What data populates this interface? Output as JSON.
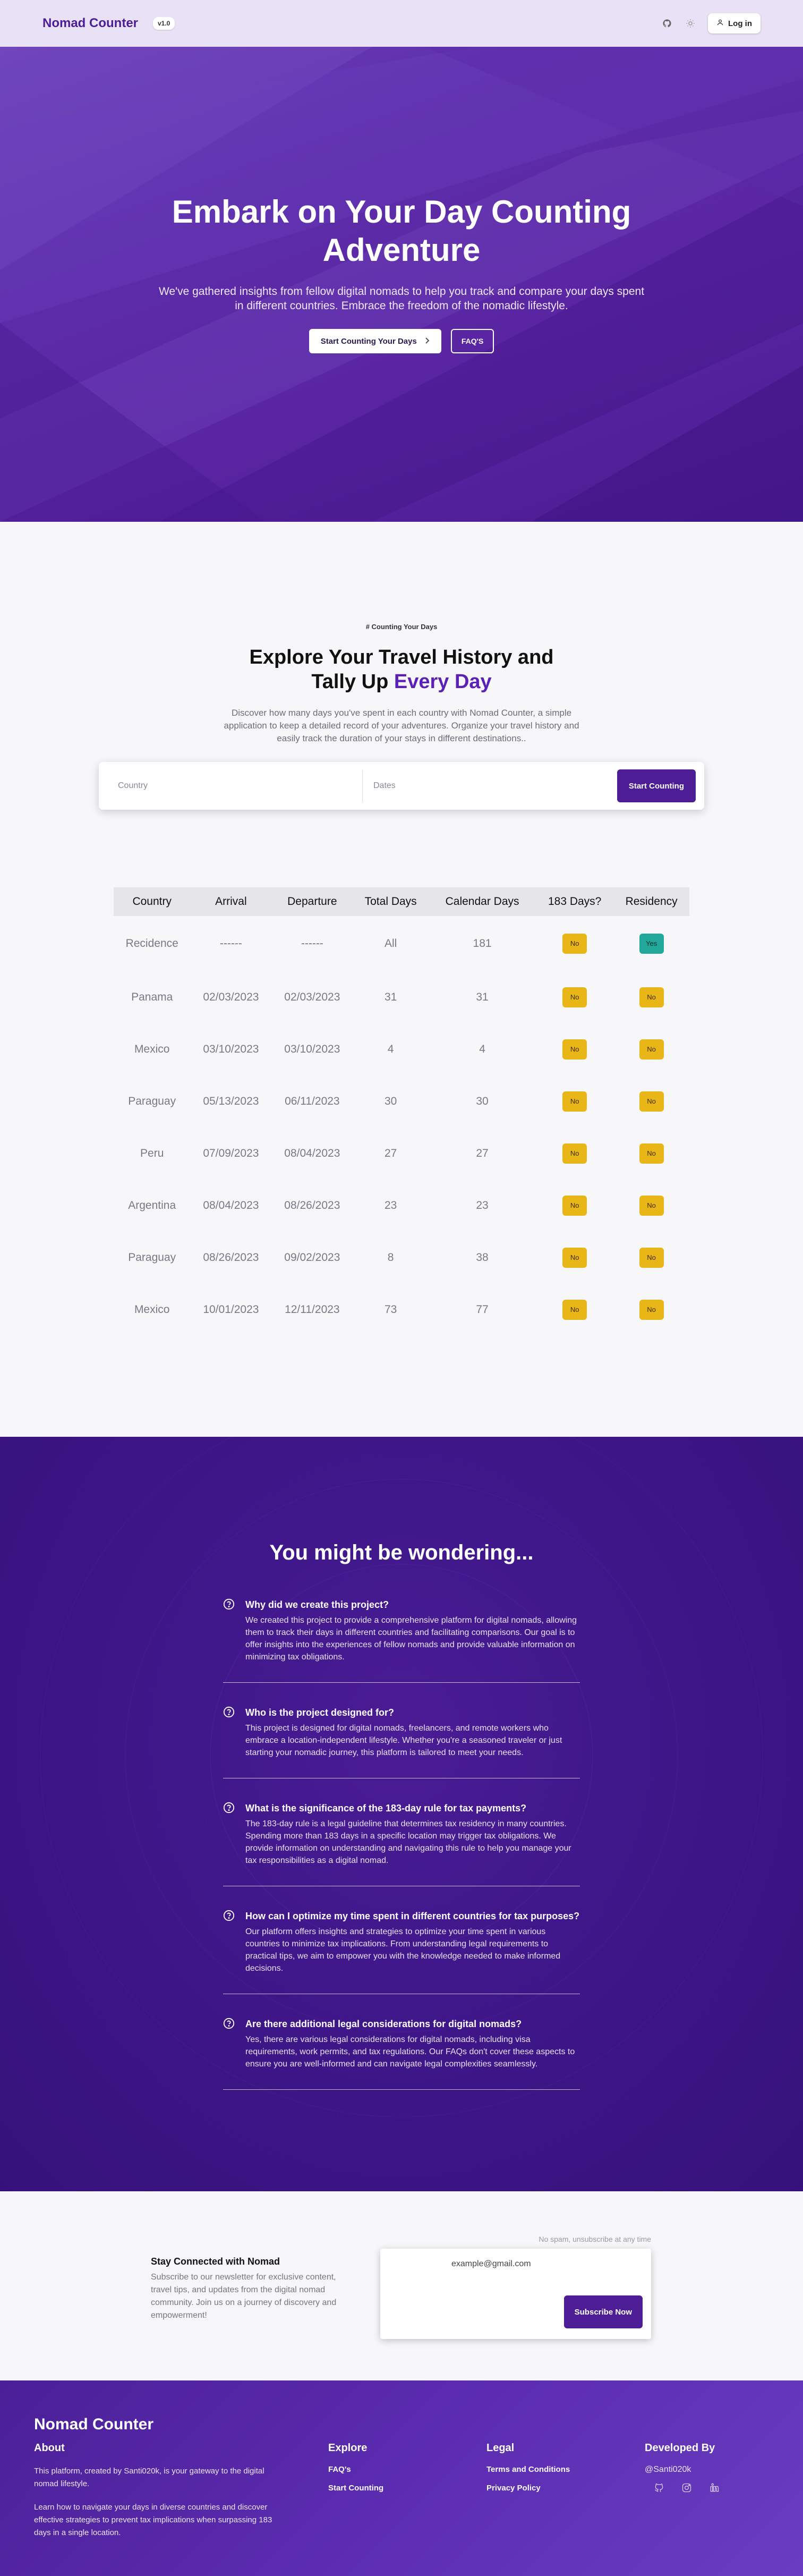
{
  "nav": {
    "brand": "Nomad Counter",
    "version": "v1.0",
    "login_label": "Log in",
    "icons": [
      "github-icon",
      "theme-toggle-icon",
      "user-icon"
    ]
  },
  "hero": {
    "title": "Embark on Your Day Counting Adventure",
    "subtitle": "We've gathered insights from fellow digital nomads to help you track and compare your days spent in different countries. Embrace the freedom of the nomadic lifestyle.",
    "primary_button": "Start Counting Your Days",
    "secondary_button": "FAQ'S"
  },
  "explore": {
    "kicker": "# Counting Your Days",
    "title_part1": "Explore Your Travel History and",
    "title_part2": "Tally Up",
    "title_accent": "Every Day",
    "description": "Discover how many days you've spent in each country with Nomad Counter, a simple application to keep a detailed record of your adventures. Organize your travel history and easily track the duration of your stays in different destinations..",
    "country_placeholder": "Country",
    "dates_placeholder": "Dates",
    "start_button": "Start Counting"
  },
  "table": {
    "headers": [
      "Country",
      "Arrival",
      "Departure",
      "Total Days",
      "Calendar Days",
      "183 Days?",
      "Residency"
    ],
    "rows": [
      {
        "country": "Recidence",
        "arrival": "------",
        "departure": "------",
        "total": "All",
        "calendar": "181",
        "d183": "No",
        "residency": "Yes"
      },
      {
        "country": "Panama",
        "arrival": "02/03/2023",
        "departure": "02/03/2023",
        "total": "31",
        "calendar": "31",
        "d183": "No",
        "residency": "No"
      },
      {
        "country": "Mexico",
        "arrival": "03/10/2023",
        "departure": "03/10/2023",
        "total": "4",
        "calendar": "4",
        "d183": "No",
        "residency": "No"
      },
      {
        "country": "Paraguay",
        "arrival": "05/13/2023",
        "departure": "06/11/2023",
        "total": "30",
        "calendar": "30",
        "d183": "No",
        "residency": "No"
      },
      {
        "country": "Peru",
        "arrival": "07/09/2023",
        "departure": "08/04/2023",
        "total": "27",
        "calendar": "27",
        "d183": "No",
        "residency": "No"
      },
      {
        "country": "Argentina",
        "arrival": "08/04/2023",
        "departure": "08/26/2023",
        "total": "23",
        "calendar": "23",
        "d183": "No",
        "residency": "No"
      },
      {
        "country": "Paraguay",
        "arrival": "08/26/2023",
        "departure": "09/02/2023",
        "total": "8",
        "calendar": "38",
        "d183": "No",
        "residency": "No"
      },
      {
        "country": "Mexico",
        "arrival": "10/01/2023",
        "departure": "12/11/2023",
        "total": "73",
        "calendar": "77",
        "d183": "No",
        "residency": "No"
      }
    ]
  },
  "faq": {
    "title": "You might be wondering...",
    "items": [
      {
        "q": "Why did we create this project?",
        "a": "We created this project to provide a comprehensive platform for digital nomads, allowing them to track their days in different countries and facilitating comparisons. Our goal is to offer insights into the experiences of fellow nomads and provide valuable information on minimizing tax obligations."
      },
      {
        "q": "Who is the project designed for?",
        "a": "This project is designed for digital nomads, freelancers, and remote workers who embrace a location-independent lifestyle. Whether you're a seasoned traveler or just starting your nomadic journey, this platform is tailored to meet your needs."
      },
      {
        "q": "What is the significance of the 183-day rule for tax payments?",
        "a": "The 183-day rule is a legal guideline that determines tax residency in many countries. Spending more than 183 days in a specific location may trigger tax obligations. We provide information on understanding and navigating this rule to help you manage your tax responsibilities as a digital nomad."
      },
      {
        "q": "How can I optimize my time spent in different countries for tax purposes?",
        "a": "Our platform offers insights and strategies to optimize your time spent in various countries to minimize tax implications. From understanding legal requirements to practical tips, we aim to empower you with the knowledge needed to make informed decisions."
      },
      {
        "q": "Are there additional legal considerations for digital nomads?",
        "a": "Yes, there are various legal considerations for digital nomads, including visa requirements, work permits, and tax regulations. Our FAQs don't cover these aspects to ensure you are well-informed and can navigate legal complexities seamlessly."
      }
    ]
  },
  "newsletter": {
    "note": "No spam, unsubscribe at any time",
    "title": "Stay Connected with Nomad",
    "description": "Subscribe to our newsletter for exclusive content, travel tips, and updates from the digital nomad community. Join us on a journey of discovery and empowerment!",
    "email_placeholder": "example@gmail.com",
    "button": "Subscribe Now"
  },
  "footer": {
    "brand": "Nomad Counter",
    "about_head": "About",
    "about_text1": "This platform, created by Santi020k, is your gateway to the digital nomad lifestyle.",
    "about_text2": "Learn how to navigate your days in diverse countries and discover effective strategies to prevent tax implications when surpassing 183 days in a single location.",
    "explore_head": "Explore",
    "explore_links": [
      "FAQ's",
      "Start Counting"
    ],
    "legal_head": "Legal",
    "legal_links": [
      "Terms and Conditions",
      "Privacy Policy"
    ],
    "dev_head": "Developed By",
    "dev_handle": "@Santi020k",
    "social_icons": [
      "github-icon",
      "instagram-icon",
      "linkedin-icon"
    ]
  }
}
